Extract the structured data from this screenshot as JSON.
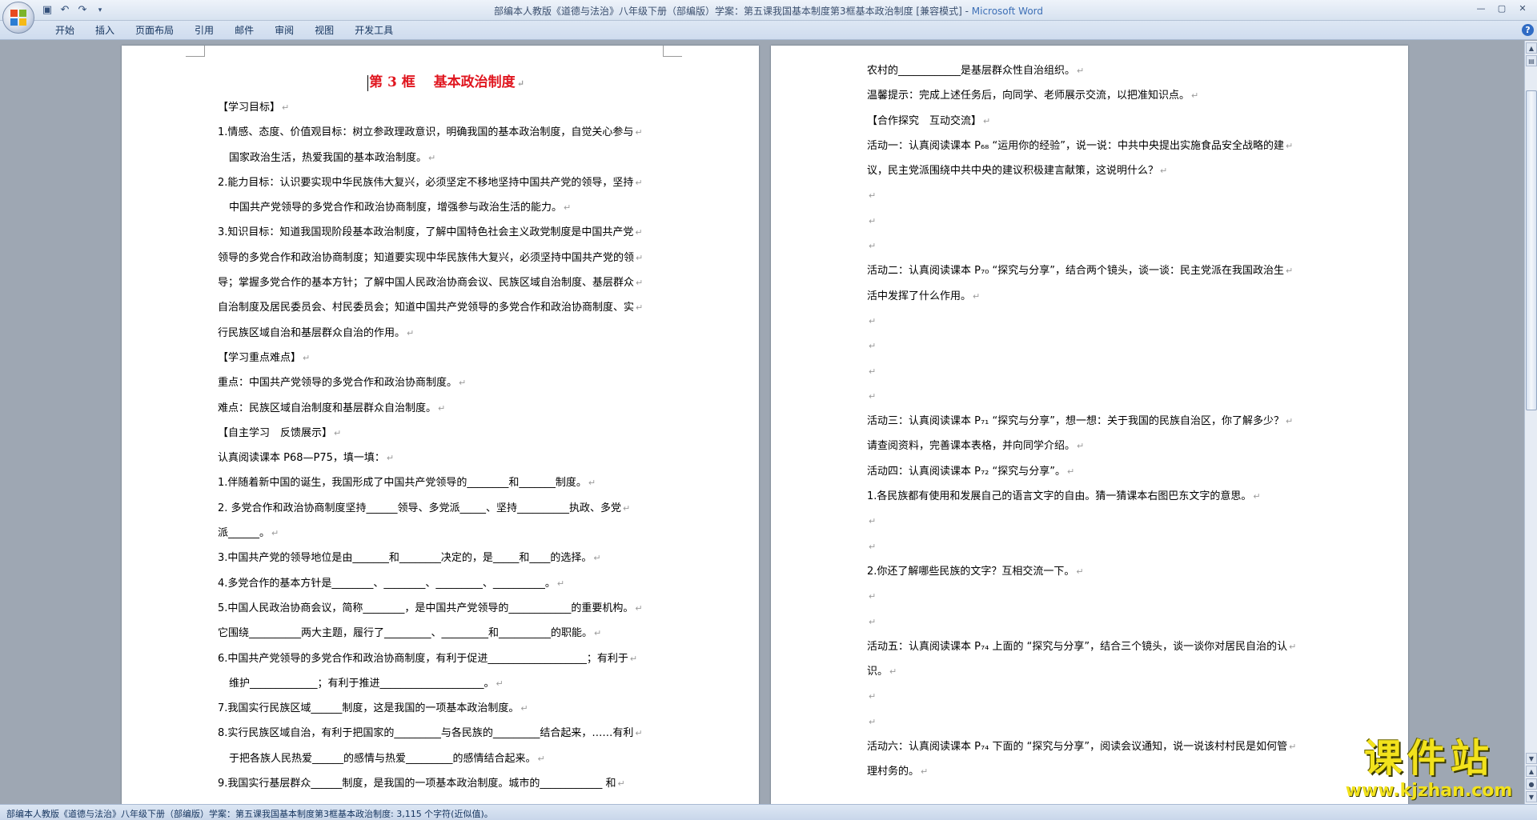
{
  "window": {
    "title_prefix": "部编本人教版《道德与法治》八年级下册（部编版）学案：第五课我国基本制度第3框基本政治制度 [兼容模式] - ",
    "app_name": "Microsoft Word"
  },
  "ribbon": {
    "tabs": [
      "开始",
      "插入",
      "页面布局",
      "引用",
      "邮件",
      "审阅",
      "视图",
      "开发工具"
    ]
  },
  "page1": {
    "title": "第 3 框　 基本政治制度",
    "lines": [
      "【学习目标】",
      "1.情感、态度、价值观目标：树立参政理政意识，明确我国的基本政治制度，自觉关心参与",
      "国家政治生活，热爱我国的基本政治制度。",
      "2.能力目标：认识要实现中华民族伟大复兴，必须坚定不移地坚持中国共产党的领导，坚持",
      "中国共产党领导的多党合作和政治协商制度，增强参与政治生活的能力。",
      "3.知识目标：知道我国现阶段基本政治制度，了解中国特色社会主义政党制度是中国共产党",
      "领导的多党合作和政治协商制度；知道要实现中华民族伟大复兴，必须坚持中国共产党的领",
      "导；掌握多党合作的基本方针；了解中国人民政治协商会议、民族区域自治制度、基层群众",
      "自治制度及居民委员会、村民委员会；知道中国共产党领导的多党合作和政治协商制度、实",
      "行民族区域自治和基层群众自治的作用。",
      "【学习重点难点】",
      "重点：中国共产党领导的多党合作和政治协商制度。",
      "难点：民族区域自治制度和基层群众自治制度。",
      "【自主学习　反馈展示】",
      "认真阅读课本 P68—P75，填一填：",
      "1.伴随着新中国的诞生，我国形成了中国共产党领导的________和_______制度。",
      "2. 多党合作和政治协商制度坚持______领导、多党派_____、坚持__________执政、多党",
      "派______。",
      "3.中国共产党的领导地位是由_______和________决定的，是_____和____的选择。",
      "4.多党合作的基本方针是________、________、_________、__________。",
      "5.中国人民政治协商会议，简称________，是中国共产党领导的____________的重要机构。",
      "它围绕__________两大主题，履行了_________、_________和__________的职能。",
      "6.中国共产党领导的多党合作和政治协商制度，有利于促进___________________；有利于",
      "维护_____________；有利于推进____________________。",
      "7.我国实行民族区域______制度，这是我国的一项基本政治制度。",
      "8.实行民族区域自治，有利于把国家的_________与各民族的_________结合起来，……有利",
      "于把各族人民热爱______的感情与热爱_________的感情结合起来。",
      "9.我国实行基层群众______制度，是我国的一项基本政治制度。城市的____________ 和"
    ]
  },
  "page2": {
    "lines": [
      "农村的____________是基层群众性自治组织。",
      "温馨提示：完成上述任务后，向同学、老师展示交流，以把准知识点。",
      "【合作探究　互动交流】",
      "活动一：认真阅读课本 P₆₈ “运用你的经验”，说一说：中共中央提出实施食品安全战略的建",
      "议，民主党派围绕中共中央的建议积极建言献策，这说明什么？",
      "",
      "",
      "",
      "活动二：认真阅读课本 P₇₀ “探究与分享”，结合两个镜头，谈一谈：民主党派在我国政治生",
      "活中发挥了什么作用。",
      "",
      "",
      "",
      "",
      "活动三：认真阅读课本 P₇₁ “探究与分享”，想一想：关于我国的民族自治区，你了解多少？",
      "请查阅资料，完善课本表格，并向同学介绍。",
      "活动四：认真阅读课本 P₇₂ “探究与分享”。",
      "1.各民族都有使用和发展自己的语言文字的自由。猜一猜课本右图巴东文字的意思。",
      "",
      "",
      "2.你还了解哪些民族的文字？互相交流一下。",
      "",
      "",
      "活动五：认真阅读课本 P₇₄ 上面的 “探究与分享”，结合三个镜头，谈一谈你对居民自治的认",
      "识。",
      "",
      "",
      "活动六：认真阅读课本 P₇₄ 下面的 “探究与分享”，阅读会议通知，说一说该村村民是如何管",
      "理村务的。"
    ]
  },
  "statusbar": {
    "text": "部编本人教版《道德与法治》八年级下册（部编版）学案：第五课我国基本制度第3框基本政治制度: 3,115 个字符(近似值)。"
  },
  "watermark": {
    "text": "课件站",
    "url": "www.kjzhan.com"
  },
  "icons": [
    "office-button-icon",
    "save-icon",
    "undo-icon",
    "redo-icon",
    "customize-qat-icon",
    "minimize-icon",
    "maximize-icon",
    "close-icon",
    "help-icon",
    "paragraph-mark-icon"
  ]
}
